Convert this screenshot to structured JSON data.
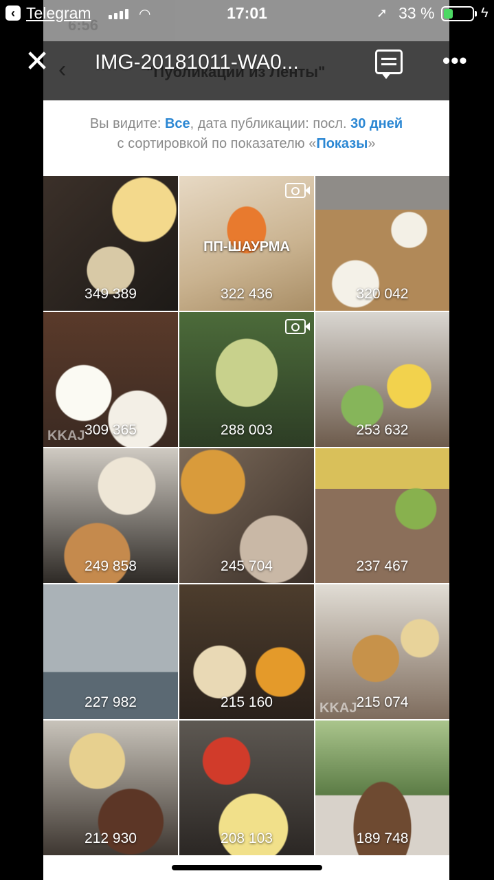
{
  "telegram_status": {
    "back_app": "Telegram",
    "time": "17:01",
    "battery_pct_label": "33 %",
    "battery_level": 0.33
  },
  "viewer": {
    "title": "IMG-20181011-WA0...",
    "close_icon": "close-icon",
    "share_icon": "share-icon",
    "more_icon": "more-icon"
  },
  "embedded": {
    "status_time": "6:56",
    "nav_title": "\"Публикации из Ленты\"",
    "info": {
      "prefix": "Вы видите: ",
      "filter_value": "Все",
      "middle": ", дата публикации: посл. ",
      "period_value": "30 дней",
      "line2_prefix": "с сортировкой по показателю «",
      "sort_value": "Показы",
      "line2_suffix": "»"
    },
    "posts": [
      {
        "count": "349 389"
      },
      {
        "count": "322 436",
        "video": true,
        "overlay": "ПП-ШАУРМА"
      },
      {
        "count": "320 042"
      },
      {
        "count": "309 365",
        "watermark": "KKAJ"
      },
      {
        "count": "288 003",
        "video": true
      },
      {
        "count": "253 632"
      },
      {
        "count": "249 858"
      },
      {
        "count": "245 704"
      },
      {
        "count": "237 467"
      },
      {
        "count": "227 982"
      },
      {
        "count": "215 160"
      },
      {
        "count": "215 074",
        "watermark": "KKAJ"
      },
      {
        "count": "212 930"
      },
      {
        "count": "208 103"
      },
      {
        "count": "189 748"
      }
    ]
  }
}
